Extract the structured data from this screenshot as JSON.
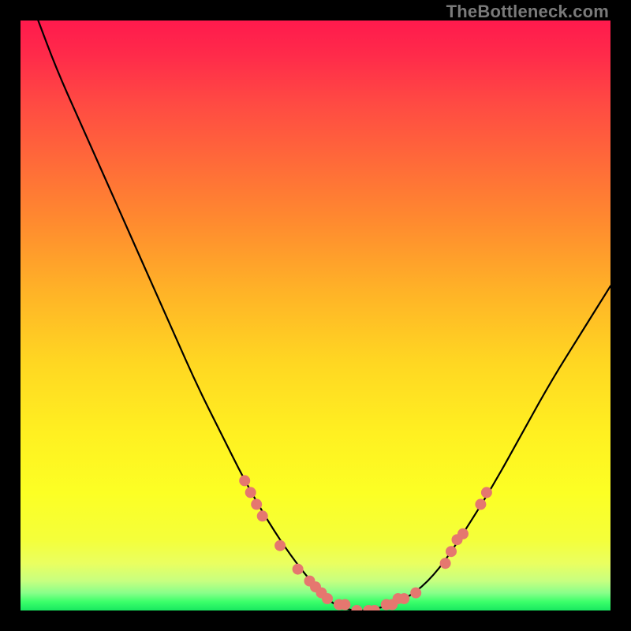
{
  "watermark": "TheBottleneck.com",
  "chart_data": {
    "type": "line",
    "title": "",
    "xlabel": "",
    "ylabel": "",
    "xlim": [
      0,
      100
    ],
    "ylim": [
      0,
      100
    ],
    "grid": false,
    "legend": false,
    "background_gradient": {
      "direction": "vertical",
      "stops": [
        {
          "pos": 0,
          "color": "#ff1a4d"
        },
        {
          "pos": 50,
          "color": "#ffc924"
        },
        {
          "pos": 90,
          "color": "#f4ff3a"
        },
        {
          "pos": 100,
          "color": "#18e860"
        }
      ]
    },
    "series": [
      {
        "name": "bottleneck-curve",
        "x": [
          3,
          6,
          10,
          14,
          18,
          22,
          26,
          30,
          34,
          38,
          42,
          46,
          50,
          53,
          56,
          59,
          63,
          67,
          71,
          75,
          80,
          85,
          90,
          95,
          100
        ],
        "y": [
          100,
          92,
          83,
          74,
          65,
          56,
          47,
          38,
          30,
          22,
          15,
          9,
          4,
          1,
          0,
          0,
          1,
          3,
          7,
          13,
          21,
          30,
          39,
          47,
          55
        ]
      }
    ],
    "highlight_points": {
      "name": "marked-segments",
      "color": "#e5776f",
      "points": [
        {
          "x": 38,
          "y": 22
        },
        {
          "x": 39,
          "y": 20
        },
        {
          "x": 40,
          "y": 18
        },
        {
          "x": 41,
          "y": 16
        },
        {
          "x": 44,
          "y": 11
        },
        {
          "x": 47,
          "y": 7
        },
        {
          "x": 49,
          "y": 5
        },
        {
          "x": 50,
          "y": 4
        },
        {
          "x": 51,
          "y": 3
        },
        {
          "x": 52,
          "y": 2
        },
        {
          "x": 54,
          "y": 1
        },
        {
          "x": 55,
          "y": 1
        },
        {
          "x": 57,
          "y": 0
        },
        {
          "x": 59,
          "y": 0
        },
        {
          "x": 60,
          "y": 0
        },
        {
          "x": 62,
          "y": 1
        },
        {
          "x": 63,
          "y": 1
        },
        {
          "x": 64,
          "y": 2
        },
        {
          "x": 65,
          "y": 2
        },
        {
          "x": 67,
          "y": 3
        },
        {
          "x": 72,
          "y": 8
        },
        {
          "x": 73,
          "y": 10
        },
        {
          "x": 74,
          "y": 12
        },
        {
          "x": 75,
          "y": 13
        },
        {
          "x": 78,
          "y": 18
        },
        {
          "x": 79,
          "y": 20
        }
      ]
    }
  }
}
